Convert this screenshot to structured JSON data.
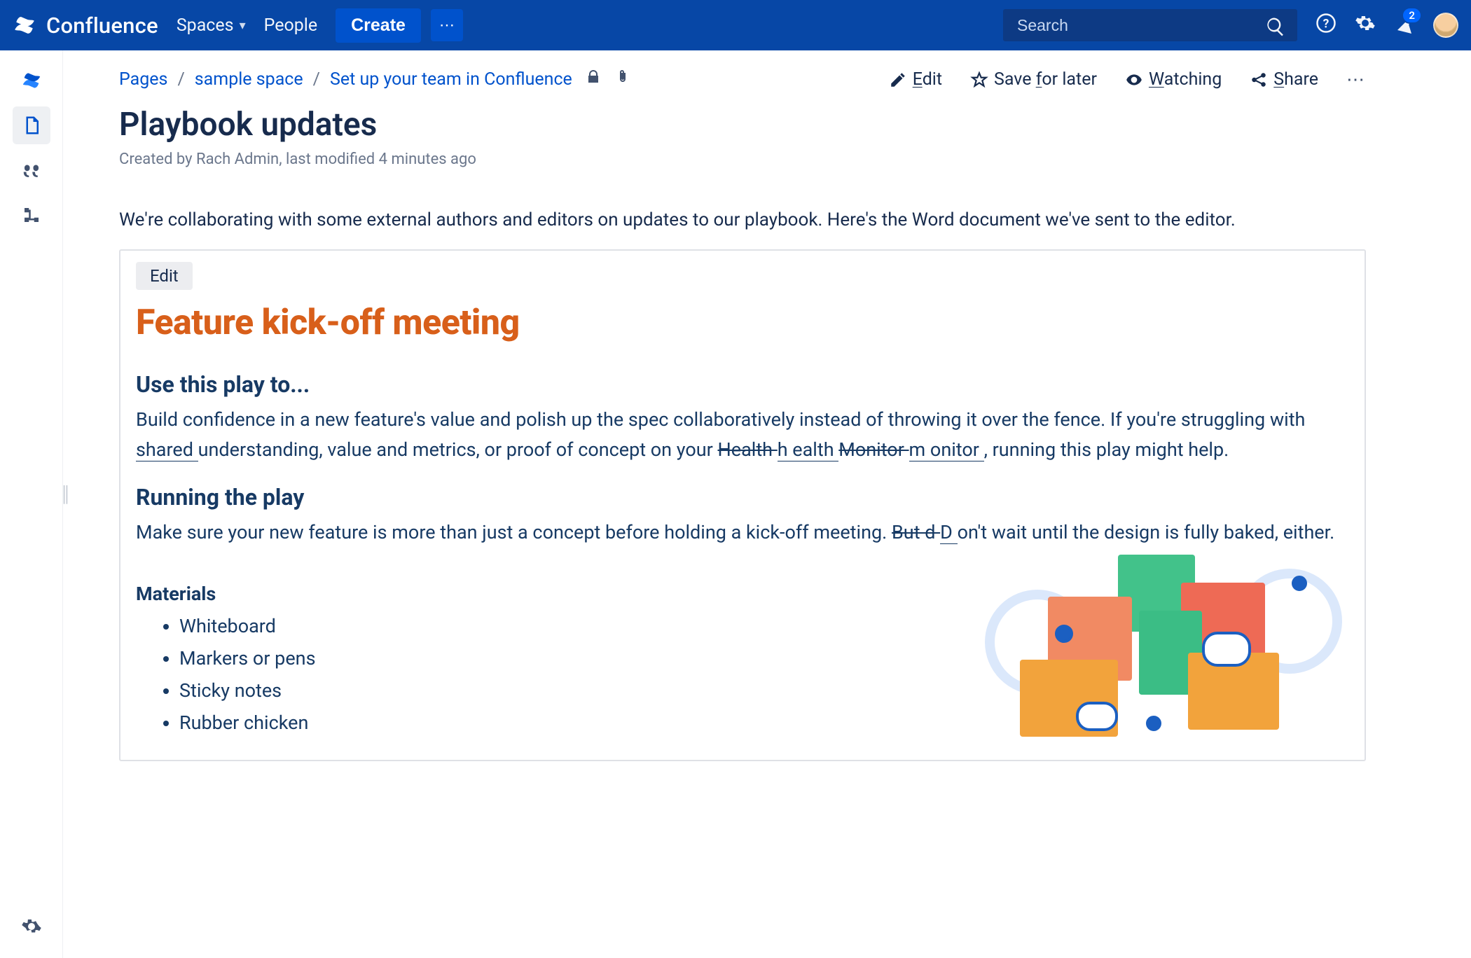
{
  "nav": {
    "brand": "Confluence",
    "spaces": "Spaces",
    "people": "People",
    "create": "Create",
    "search_placeholder": "Search",
    "notification_count": "2"
  },
  "breadcrumbs": {
    "pages": "Pages",
    "space": "sample space",
    "parent": "Set up your team in Confluence"
  },
  "actions": {
    "edit": "Edit",
    "edit_u": "E",
    "save": "Save for later",
    "save_u": "f",
    "watch": "Watching",
    "watch_u": "W",
    "share": "Share",
    "share_u": "S"
  },
  "page": {
    "title": "Playbook updates",
    "byline": "Created by Rach Admin, last modified 4 minutes ago",
    "intro": "We're collaborating with some external authors and editors on updates to our playbook.  Here's the Word document we've sent to the editor."
  },
  "doc": {
    "edit_chip": "Edit",
    "h1": "Feature kick-off meeting",
    "h2a": "Use this play to...",
    "p1_a": "Build confidence in a new feature's value and polish up the spec collaboratively instead of throwing it over the fence. If you're struggling with ",
    "p1_shared": "shared ",
    "p1_b": "understanding, value and metrics, or proof of concept on your ",
    "p1_s1": "Health ",
    "p1_i1": "h ealth ",
    "p1_s2": "Monitor ",
    "p1_i2": "m onitor ",
    "p1_c": ", running this play might help.",
    "h2b": "Running the play",
    "p2_a": "Make sure your new feature is more than just a concept before holding a kick-off meeting. ",
    "p2_s": "But d ",
    "p2_i": "D ",
    "p2_b": "on't wait until the design is fully baked, either.",
    "h3": "Materials",
    "materials": [
      "Whiteboard",
      "Markers or pens",
      "Sticky notes",
      "Rubber chicken"
    ]
  }
}
